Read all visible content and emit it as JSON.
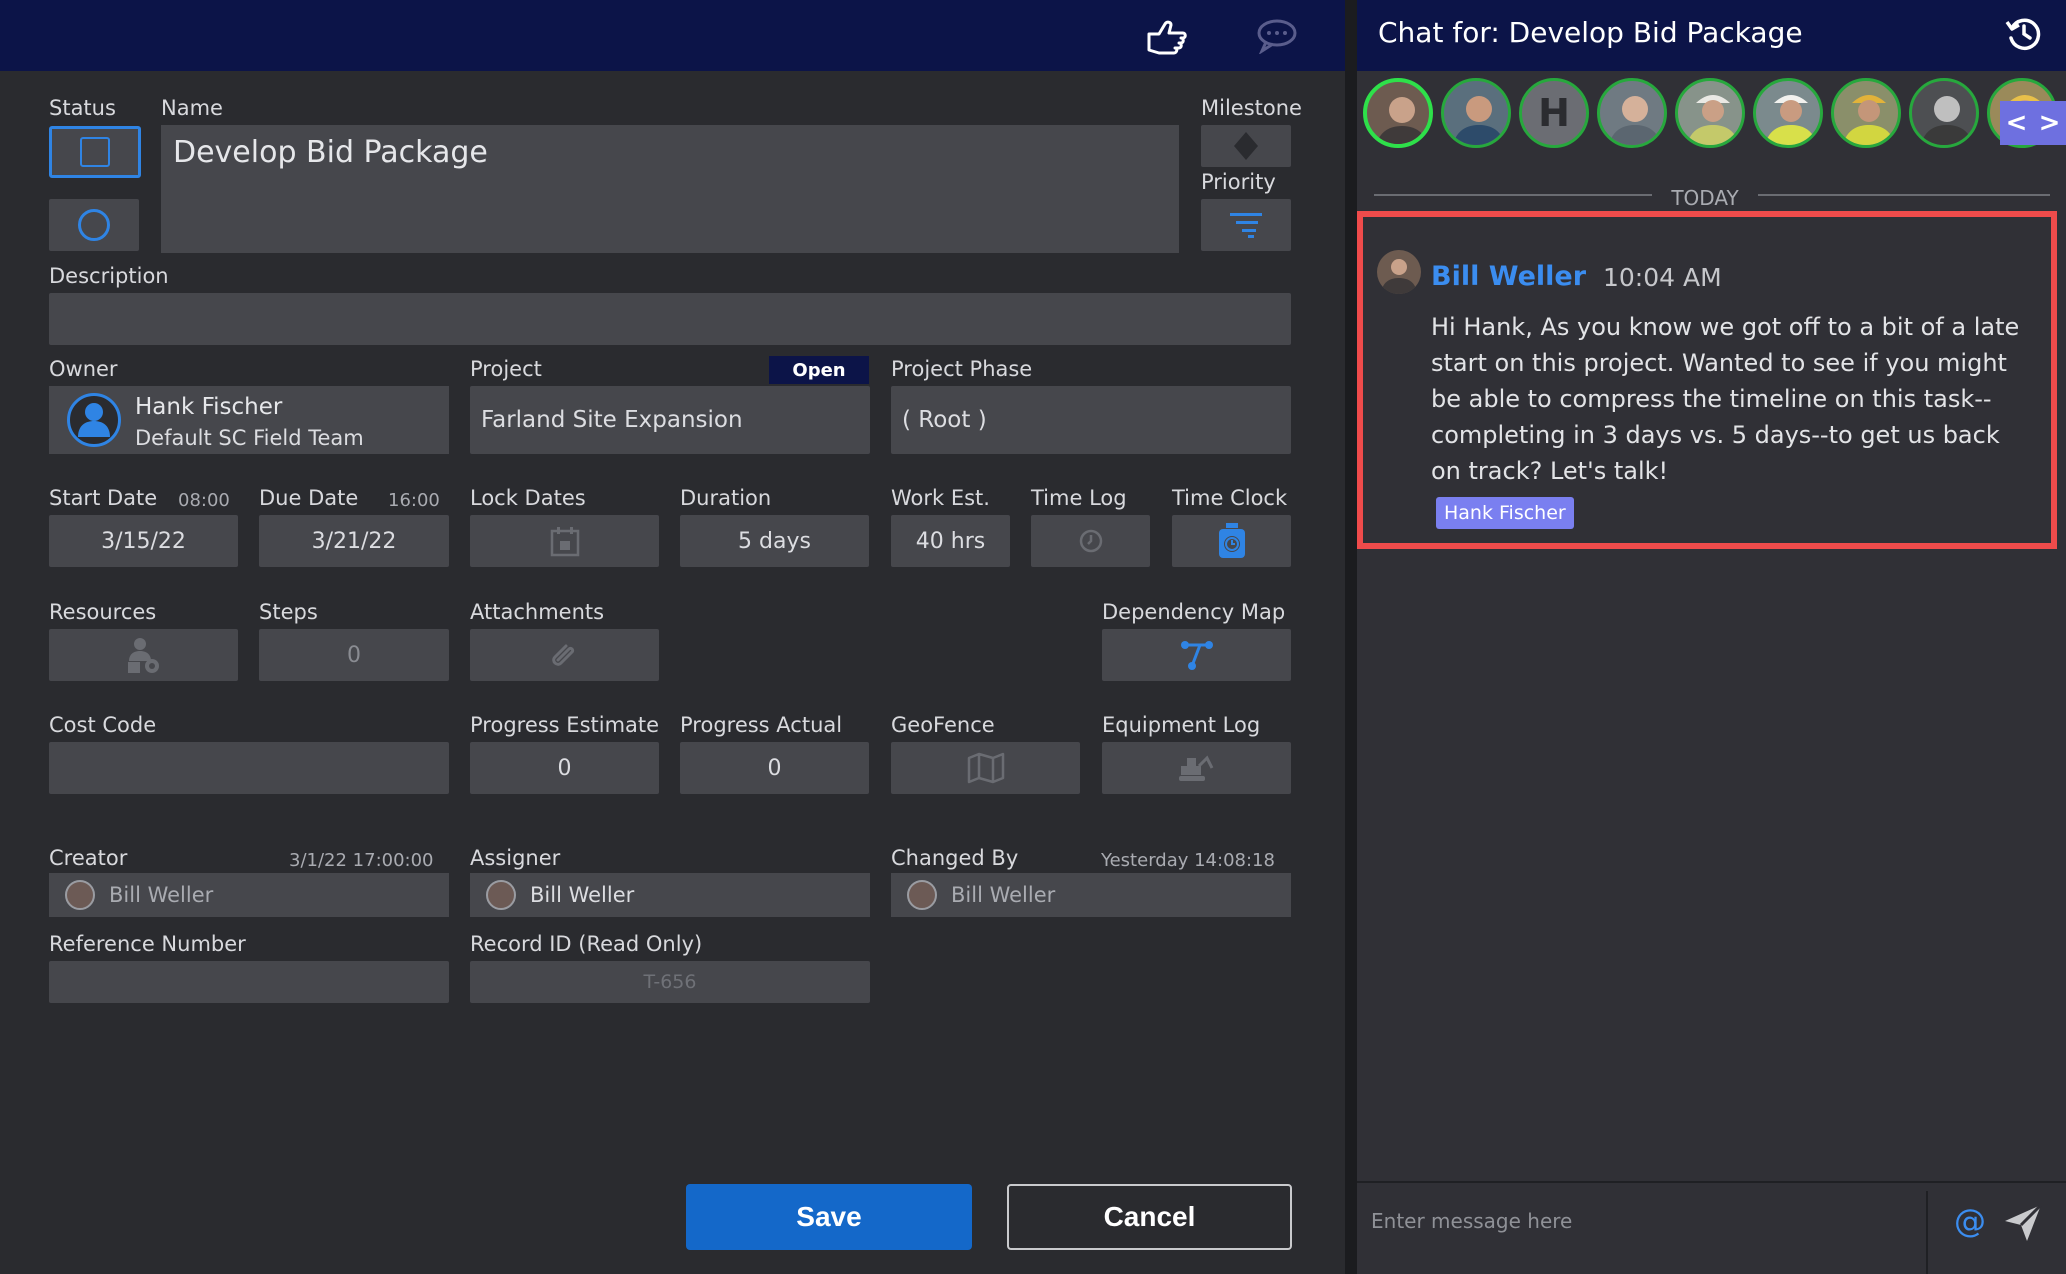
{
  "topbar": {
    "icons": [
      "pointing-hand-icon",
      "chat-bubble-icon"
    ]
  },
  "form": {
    "status_label": "Status",
    "name_label": "Name",
    "name_value": "Develop Bid Package",
    "milestone_label": "Milestone",
    "priority_label": "Priority",
    "description_label": "Description",
    "description_value": "",
    "owner_label": "Owner",
    "owner_name": "Hank Fischer",
    "owner_team": "Default SC Field Team",
    "project_label": "Project",
    "project_badge": "Open",
    "project_value": "Farland Site Expansion",
    "phase_label": "Project Phase",
    "phase_value": "( Root )",
    "start_label": "Start Date",
    "start_time": "08:00",
    "start_value": "3/15/22",
    "due_label": "Due Date",
    "due_time": "16:00",
    "due_value": "3/21/22",
    "lock_label": "Lock Dates",
    "duration_label": "Duration",
    "duration_value": "5 days",
    "work_label": "Work Est.",
    "work_value": "40 hrs",
    "timelog_label": "Time Log",
    "timeclock_label": "Time Clock",
    "resources_label": "Resources",
    "steps_label": "Steps",
    "steps_value": "0",
    "attachments_label": "Attachments",
    "depmap_label": "Dependency Map",
    "costcode_label": "Cost Code",
    "prog_est_label": "Progress Estimate",
    "prog_est_value": "0",
    "prog_act_label": "Progress Actual",
    "prog_act_value": "0",
    "geofence_label": "GeoFence",
    "equip_label": "Equipment Log",
    "creator_label": "Creator",
    "creator_date": "3/1/22  17:00:00",
    "creator_value": "Bill Weller",
    "assigner_label": "Assigner",
    "assigner_value": "Bill Weller",
    "changed_label": "Changed By",
    "changed_date": "Yesterday  14:08:18",
    "changed_value": "Bill Weller",
    "refnum_label": "Reference Number",
    "refnum_value": "",
    "record_label": "Record ID (Read Only)",
    "record_value": "T-656",
    "save_label": "Save",
    "cancel_label": "Cancel"
  },
  "chat": {
    "title": "Chat for: Develop Bid Package",
    "avatar_letter": "H",
    "today_label": "TODAY",
    "message": {
      "author": "Bill Weller",
      "time": "10:04 AM",
      "text": "Hi Hank, As you know we got off to a bit of a late start on this project. Wanted to see if you might be able to compress the timeline on this task--completing in 3 days vs. 5 days--to get us back on track? Let's talk!",
      "mention": "Hank Fischer"
    },
    "input_placeholder": "Enter message here",
    "at_symbol": "@",
    "nav_prev": "<",
    "nav_next": ">"
  },
  "colors": {
    "accent": "#2f84e4",
    "header": "#0c1448",
    "highlight": "#ef4b4b",
    "mention": "#7a7ff0",
    "online": "#27a83d"
  }
}
